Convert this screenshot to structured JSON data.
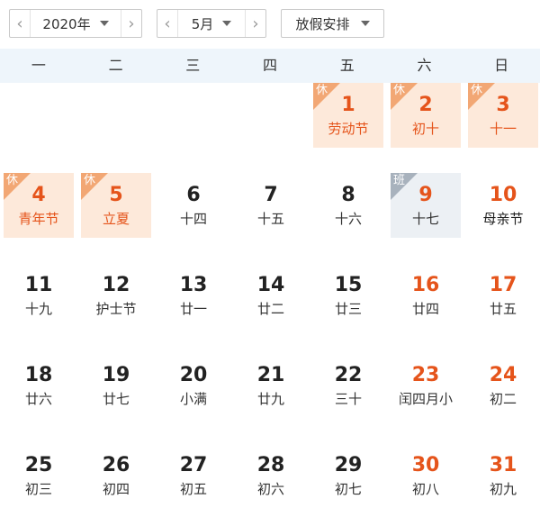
{
  "toolbar": {
    "year_value": "2020年",
    "month_value": "5月",
    "holiday_select": "放假安排",
    "prev_glyph": "‹",
    "next_glyph": "›"
  },
  "weekdays": [
    "一",
    "二",
    "三",
    "四",
    "五",
    "六",
    "日"
  ],
  "colors": {
    "holiday_bg": "#fde9da",
    "holiday_tag": "#f2a774",
    "work_bg": "#ecf0f4",
    "work_tag": "#a8b2bd",
    "red": "#e5541b"
  },
  "days": [
    {
      "num": "1",
      "sub": "劳动节",
      "tag": "休",
      "type": "holiday"
    },
    {
      "num": "2",
      "sub": "初十",
      "tag": "休",
      "type": "holiday"
    },
    {
      "num": "3",
      "sub": "十一",
      "tag": "休",
      "type": "holiday"
    },
    {
      "num": "4",
      "sub": "青年节",
      "tag": "休",
      "type": "holiday"
    },
    {
      "num": "5",
      "sub": "立夏",
      "tag": "休",
      "type": "holiday"
    },
    {
      "num": "6",
      "sub": "十四",
      "type": "normal"
    },
    {
      "num": "7",
      "sub": "十五",
      "type": "normal"
    },
    {
      "num": "8",
      "sub": "十六",
      "type": "normal"
    },
    {
      "num": "9",
      "sub": "十七",
      "tag": "班",
      "type": "work"
    },
    {
      "num": "10",
      "sub": "母亲节",
      "type": "weekend-black"
    },
    {
      "num": "11",
      "sub": "十九",
      "type": "normal"
    },
    {
      "num": "12",
      "sub": "护士节",
      "type": "normal"
    },
    {
      "num": "13",
      "sub": "廿一",
      "type": "normal"
    },
    {
      "num": "14",
      "sub": "廿二",
      "type": "normal"
    },
    {
      "num": "15",
      "sub": "廿三",
      "type": "normal"
    },
    {
      "num": "16",
      "sub": "廿四",
      "type": "weekend"
    },
    {
      "num": "17",
      "sub": "廿五",
      "type": "weekend"
    },
    {
      "num": "18",
      "sub": "廿六",
      "type": "normal"
    },
    {
      "num": "19",
      "sub": "廿七",
      "type": "normal"
    },
    {
      "num": "20",
      "sub": "小满",
      "type": "normal"
    },
    {
      "num": "21",
      "sub": "廿九",
      "type": "normal"
    },
    {
      "num": "22",
      "sub": "三十",
      "type": "normal"
    },
    {
      "num": "23",
      "sub": "闰四月小",
      "type": "weekend"
    },
    {
      "num": "24",
      "sub": "初二",
      "type": "weekend"
    },
    {
      "num": "25",
      "sub": "初三",
      "type": "normal"
    },
    {
      "num": "26",
      "sub": "初四",
      "type": "normal"
    },
    {
      "num": "27",
      "sub": "初五",
      "type": "normal"
    },
    {
      "num": "28",
      "sub": "初六",
      "type": "normal"
    },
    {
      "num": "29",
      "sub": "初七",
      "type": "normal"
    },
    {
      "num": "30",
      "sub": "初八",
      "type": "weekend"
    },
    {
      "num": "31",
      "sub": "初九",
      "type": "weekend"
    }
  ],
  "first_weekday_index": 4
}
